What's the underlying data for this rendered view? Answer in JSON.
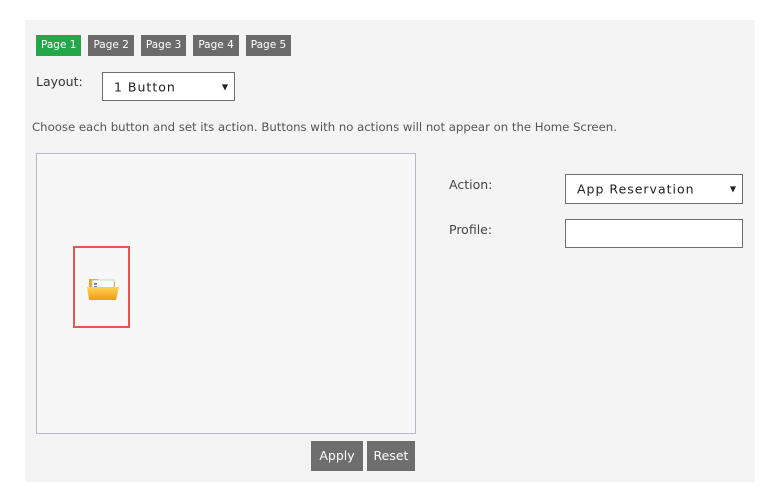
{
  "tabs": [
    {
      "label": "Page 1",
      "active": true
    },
    {
      "label": "Page 2",
      "active": false
    },
    {
      "label": "Page 3",
      "active": false
    },
    {
      "label": "Page 4",
      "active": false
    },
    {
      "label": "Page 5",
      "active": false
    }
  ],
  "layout": {
    "label": "Layout:",
    "value": "1 Button"
  },
  "instructions": "Choose each button and set its action. Buttons with no actions will not appear on the Home Screen.",
  "canvas": {
    "button_icon": "folder-icon"
  },
  "buttons": {
    "apply": "Apply",
    "reset": "Reset"
  },
  "action": {
    "label": "Action:",
    "value": "App Reservation"
  },
  "profile": {
    "label": "Profile:",
    "value": ""
  },
  "colors": {
    "active_tab": "#22a84b",
    "tab": "#6b6b6b",
    "selection_border": "#e8554e",
    "button": "#6e6e6e"
  }
}
